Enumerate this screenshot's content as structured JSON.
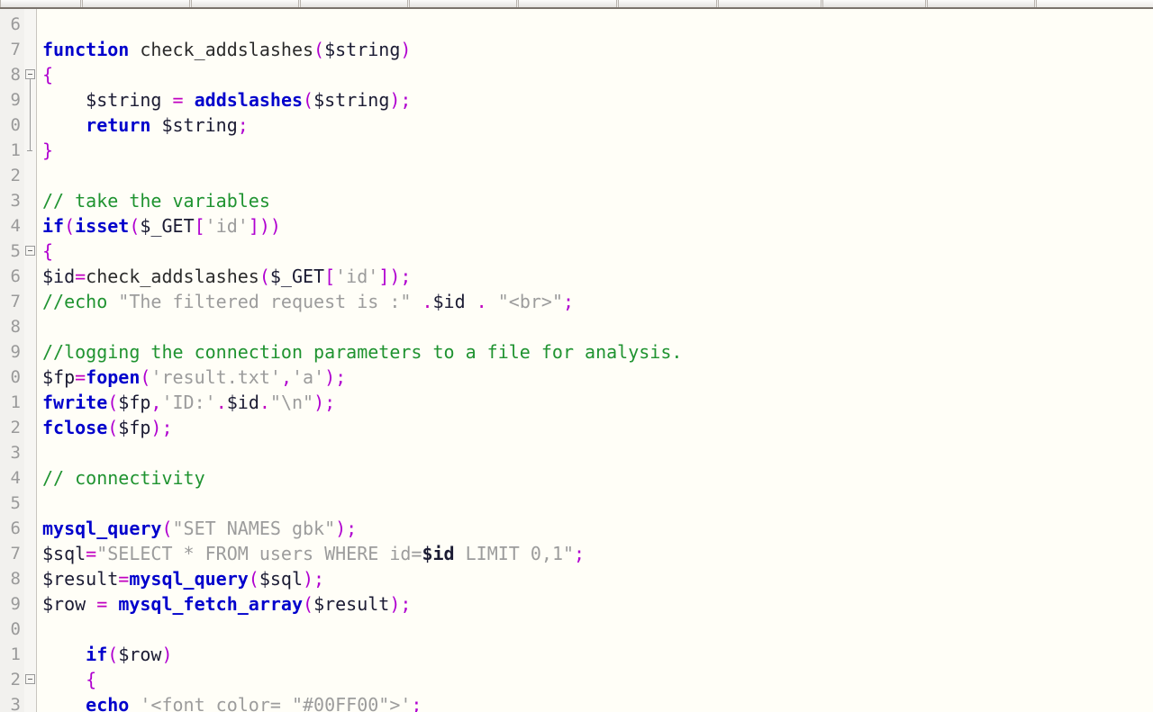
{
  "app": {
    "kind": "source-code-editor",
    "language": "PHP",
    "background_color": "#FFFEF7",
    "gutter_color": "#F2F1EE"
  },
  "toolbar": {
    "visible_sliver": true,
    "groups": [
      90,
      120,
      120,
      120,
      120,
      110,
      110,
      115,
      115,
      120
    ]
  },
  "syntax_colors": {
    "keyword": "#0000CC",
    "function": "#0000CC",
    "identifier": "#2B2B2B",
    "variable": "#1B1B33",
    "operator": "#C000C0",
    "punctuation": "#B000D0",
    "string": "#9C9C9C",
    "comment": "#1F9330"
  },
  "editor": {
    "first_visible_line": 6,
    "line_height_px": 28,
    "gutter_labels": [
      "6",
      "7",
      "8",
      "9",
      "0",
      "1",
      "2",
      "3",
      "4",
      "5",
      "6",
      "7",
      "8",
      "9",
      "0",
      "1",
      "2",
      "3",
      "4",
      "5",
      "6",
      "7",
      "8",
      "9",
      "0",
      "1",
      "2",
      "3"
    ],
    "fold_markers": [
      {
        "line_index": 2,
        "type": "box-minus"
      },
      {
        "line_index": 3,
        "type": "line"
      },
      {
        "line_index": 4,
        "type": "line"
      },
      {
        "line_index": 5,
        "type": "end-tick"
      },
      {
        "line_index": 9,
        "type": "box-minus"
      },
      {
        "line_index": 26,
        "type": "box-minus"
      }
    ],
    "lines": [
      {
        "n": "6",
        "tokens": []
      },
      {
        "n": "7",
        "tokens": [
          {
            "t": "kw",
            "s": "function"
          },
          {
            "t": "plain",
            "s": " "
          },
          {
            "t": "id",
            "s": "check_addslashes"
          },
          {
            "t": "punc",
            "s": "("
          },
          {
            "t": "var",
            "s": "$string"
          },
          {
            "t": "punc",
            "s": ")"
          }
        ]
      },
      {
        "n": "8",
        "tokens": [
          {
            "t": "punc",
            "s": "{"
          }
        ]
      },
      {
        "n": "9",
        "tokens": [
          {
            "t": "plain",
            "s": "    "
          },
          {
            "t": "var",
            "s": "$string"
          },
          {
            "t": "plain",
            "s": " "
          },
          {
            "t": "op",
            "s": "="
          },
          {
            "t": "plain",
            "s": " "
          },
          {
            "t": "fn",
            "s": "addslashes"
          },
          {
            "t": "punc",
            "s": "("
          },
          {
            "t": "var",
            "s": "$string"
          },
          {
            "t": "punc",
            "s": ");"
          }
        ]
      },
      {
        "n": "0",
        "tokens": [
          {
            "t": "plain",
            "s": "    "
          },
          {
            "t": "kw",
            "s": "return"
          },
          {
            "t": "plain",
            "s": " "
          },
          {
            "t": "var",
            "s": "$string"
          },
          {
            "t": "punc",
            "s": ";"
          }
        ]
      },
      {
        "n": "1",
        "tokens": [
          {
            "t": "punc",
            "s": "}"
          }
        ]
      },
      {
        "n": "2",
        "tokens": []
      },
      {
        "n": "3",
        "tokens": [
          {
            "t": "com",
            "s": "// take the variables"
          }
        ]
      },
      {
        "n": "4",
        "tokens": [
          {
            "t": "kw",
            "s": "if"
          },
          {
            "t": "punc",
            "s": "("
          },
          {
            "t": "fn",
            "s": "isset"
          },
          {
            "t": "punc",
            "s": "("
          },
          {
            "t": "var",
            "s": "$_GET"
          },
          {
            "t": "punc",
            "s": "["
          },
          {
            "t": "str",
            "s": "'id'"
          },
          {
            "t": "punc",
            "s": "]))"
          }
        ]
      },
      {
        "n": "5",
        "tokens": [
          {
            "t": "punc",
            "s": "{"
          }
        ]
      },
      {
        "n": "6",
        "tokens": [
          {
            "t": "var",
            "s": "$id"
          },
          {
            "t": "op",
            "s": "="
          },
          {
            "t": "id",
            "s": "check_addslashes"
          },
          {
            "t": "punc",
            "s": "("
          },
          {
            "t": "var",
            "s": "$_GET"
          },
          {
            "t": "punc",
            "s": "["
          },
          {
            "t": "str",
            "s": "'id'"
          },
          {
            "t": "punc",
            "s": "]);"
          }
        ]
      },
      {
        "n": "7",
        "tokens": [
          {
            "t": "com",
            "s": "//echo "
          },
          {
            "t": "str",
            "s": "\"The filtered request is :\""
          },
          {
            "t": "plain",
            "s": " "
          },
          {
            "t": "op",
            "s": "."
          },
          {
            "t": "var",
            "s": "$id"
          },
          {
            "t": "plain",
            "s": " "
          },
          {
            "t": "op",
            "s": "."
          },
          {
            "t": "plain",
            "s": " "
          },
          {
            "t": "str",
            "s": "\"<br>\""
          },
          {
            "t": "punc",
            "s": ";"
          }
        ]
      },
      {
        "n": "8",
        "tokens": []
      },
      {
        "n": "9",
        "tokens": [
          {
            "t": "com",
            "s": "//logging the connection parameters to a file for analysis."
          }
        ]
      },
      {
        "n": "0",
        "tokens": [
          {
            "t": "var",
            "s": "$fp"
          },
          {
            "t": "op",
            "s": "="
          },
          {
            "t": "fn",
            "s": "fopen"
          },
          {
            "t": "punc",
            "s": "("
          },
          {
            "t": "str",
            "s": "'result.txt'"
          },
          {
            "t": "punc",
            "s": ","
          },
          {
            "t": "str",
            "s": "'a'"
          },
          {
            "t": "punc",
            "s": ");"
          }
        ]
      },
      {
        "n": "1",
        "tokens": [
          {
            "t": "fn",
            "s": "fwrite"
          },
          {
            "t": "punc",
            "s": "("
          },
          {
            "t": "var",
            "s": "$fp"
          },
          {
            "t": "punc",
            "s": ","
          },
          {
            "t": "str",
            "s": "'ID:'"
          },
          {
            "t": "op",
            "s": "."
          },
          {
            "t": "var",
            "s": "$id"
          },
          {
            "t": "op",
            "s": "."
          },
          {
            "t": "str",
            "s": "\"\\n\""
          },
          {
            "t": "punc",
            "s": ");"
          }
        ]
      },
      {
        "n": "2",
        "tokens": [
          {
            "t": "fn",
            "s": "fclose"
          },
          {
            "t": "punc",
            "s": "("
          },
          {
            "t": "var",
            "s": "$fp"
          },
          {
            "t": "punc",
            "s": ");"
          }
        ]
      },
      {
        "n": "3",
        "tokens": []
      },
      {
        "n": "4",
        "tokens": [
          {
            "t": "com",
            "s": "// connectivity"
          }
        ]
      },
      {
        "n": "5",
        "tokens": []
      },
      {
        "n": "6",
        "tokens": [
          {
            "t": "fn",
            "s": "mysql_query"
          },
          {
            "t": "punc",
            "s": "("
          },
          {
            "t": "str",
            "s": "\"SET NAMES gbk\""
          },
          {
            "t": "punc",
            "s": ");"
          }
        ]
      },
      {
        "n": "7",
        "tokens": [
          {
            "t": "var",
            "s": "$sql"
          },
          {
            "t": "op",
            "s": "="
          },
          {
            "t": "str",
            "s": "\"SELECT * FROM users WHERE id="
          },
          {
            "t": "varb",
            "s": "$id"
          },
          {
            "t": "str",
            "s": " LIMIT 0,1\""
          },
          {
            "t": "punc",
            "s": ";"
          }
        ]
      },
      {
        "n": "8",
        "tokens": [
          {
            "t": "var",
            "s": "$result"
          },
          {
            "t": "op",
            "s": "="
          },
          {
            "t": "fn",
            "s": "mysql_query"
          },
          {
            "t": "punc",
            "s": "("
          },
          {
            "t": "var",
            "s": "$sql"
          },
          {
            "t": "punc",
            "s": ");"
          }
        ]
      },
      {
        "n": "9",
        "tokens": [
          {
            "t": "var",
            "s": "$row"
          },
          {
            "t": "plain",
            "s": " "
          },
          {
            "t": "op",
            "s": "="
          },
          {
            "t": "plain",
            "s": " "
          },
          {
            "t": "fn",
            "s": "mysql_fetch_array"
          },
          {
            "t": "punc",
            "s": "("
          },
          {
            "t": "var",
            "s": "$result"
          },
          {
            "t": "punc",
            "s": ");"
          }
        ]
      },
      {
        "n": "0",
        "tokens": []
      },
      {
        "n": "1",
        "tokens": [
          {
            "t": "plain",
            "s": "    "
          },
          {
            "t": "kw",
            "s": "if"
          },
          {
            "t": "punc",
            "s": "("
          },
          {
            "t": "var",
            "s": "$row"
          },
          {
            "t": "punc",
            "s": ")"
          }
        ]
      },
      {
        "n": "2",
        "tokens": [
          {
            "t": "plain",
            "s": "    "
          },
          {
            "t": "punc",
            "s": "{"
          }
        ]
      },
      {
        "n": "3",
        "tokens": [
          {
            "t": "plain",
            "s": "    "
          },
          {
            "t": "kw",
            "s": "echo"
          },
          {
            "t": "plain",
            "s": " "
          },
          {
            "t": "str",
            "s": "'<font color= \"#00FF00\">'"
          },
          {
            "t": "punc",
            "s": ";"
          }
        ]
      }
    ]
  }
}
